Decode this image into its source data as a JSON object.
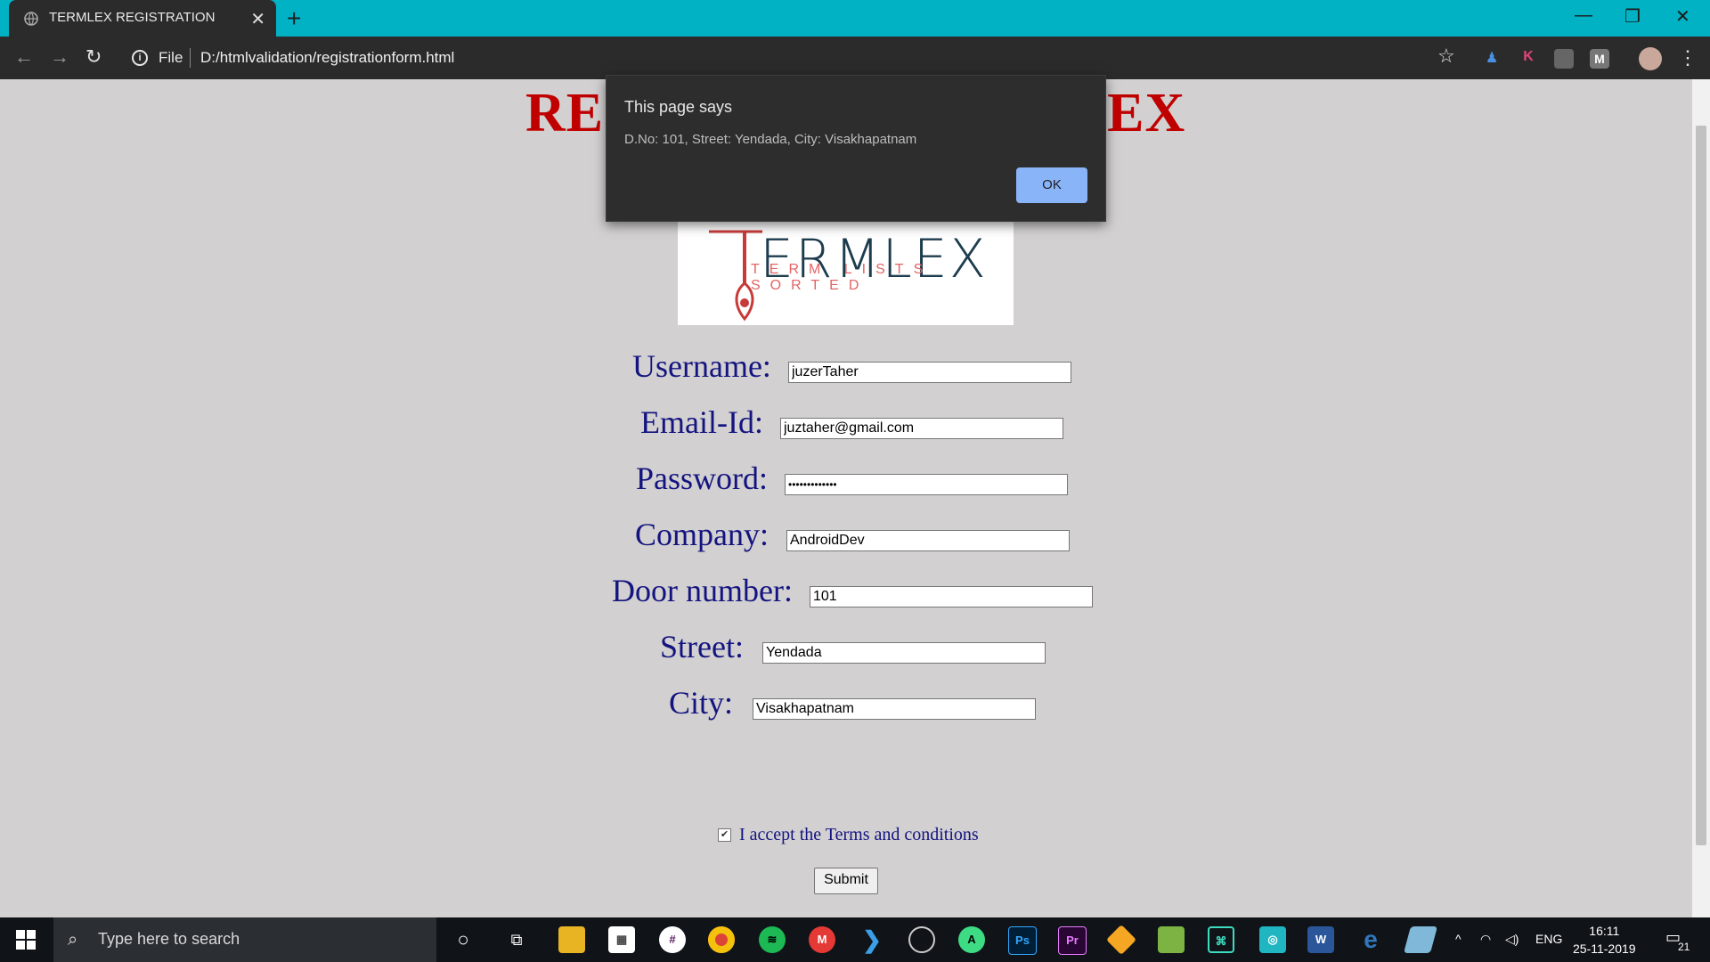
{
  "browser": {
    "tab_title": "TERMLEX REGISTRATION",
    "new_tab": "+",
    "file_label": "File",
    "url": "D:/htmlvalidation/registrationform.html",
    "tab_close": "✕",
    "minimize": "—",
    "restore": "❐",
    "close": "✕"
  },
  "page": {
    "heading_left": "RE",
    "heading_right": "EX",
    "logo_word": "ERMLEX",
    "logo_tagline": "TERM LISTS SORTED",
    "form": {
      "username_label": "Username:",
      "username_value": "juzerTaher",
      "email_label": "Email-Id:",
      "email_value": "juztaher@gmail.com",
      "password_label": "Password:",
      "password_value": "•••••••••••••",
      "company_label": "Company:",
      "company_value": "AndroidDev",
      "door_label": "Door number:",
      "door_value": "101",
      "street_label": "Street:",
      "street_value": "Yendada",
      "city_label": "City:",
      "city_value": "Visakhapatnam",
      "terms_label": "I accept the Terms and conditions",
      "terms_checked": true,
      "submit_label": "Submit"
    }
  },
  "dialog": {
    "title": "This page says",
    "message": "D.No: 101, Street: Yendada, City: Visakhapatnam",
    "ok_label": "OK"
  },
  "taskbar": {
    "search_placeholder": "Type here to search",
    "language": "ENG",
    "time": "16:11",
    "date": "25-11-2019",
    "notification_count": "21"
  },
  "colors": {
    "heading": "#c00000",
    "label": "#141480",
    "titlebar": "#01b1c4",
    "dialog_ok": "#8ab4f8"
  }
}
